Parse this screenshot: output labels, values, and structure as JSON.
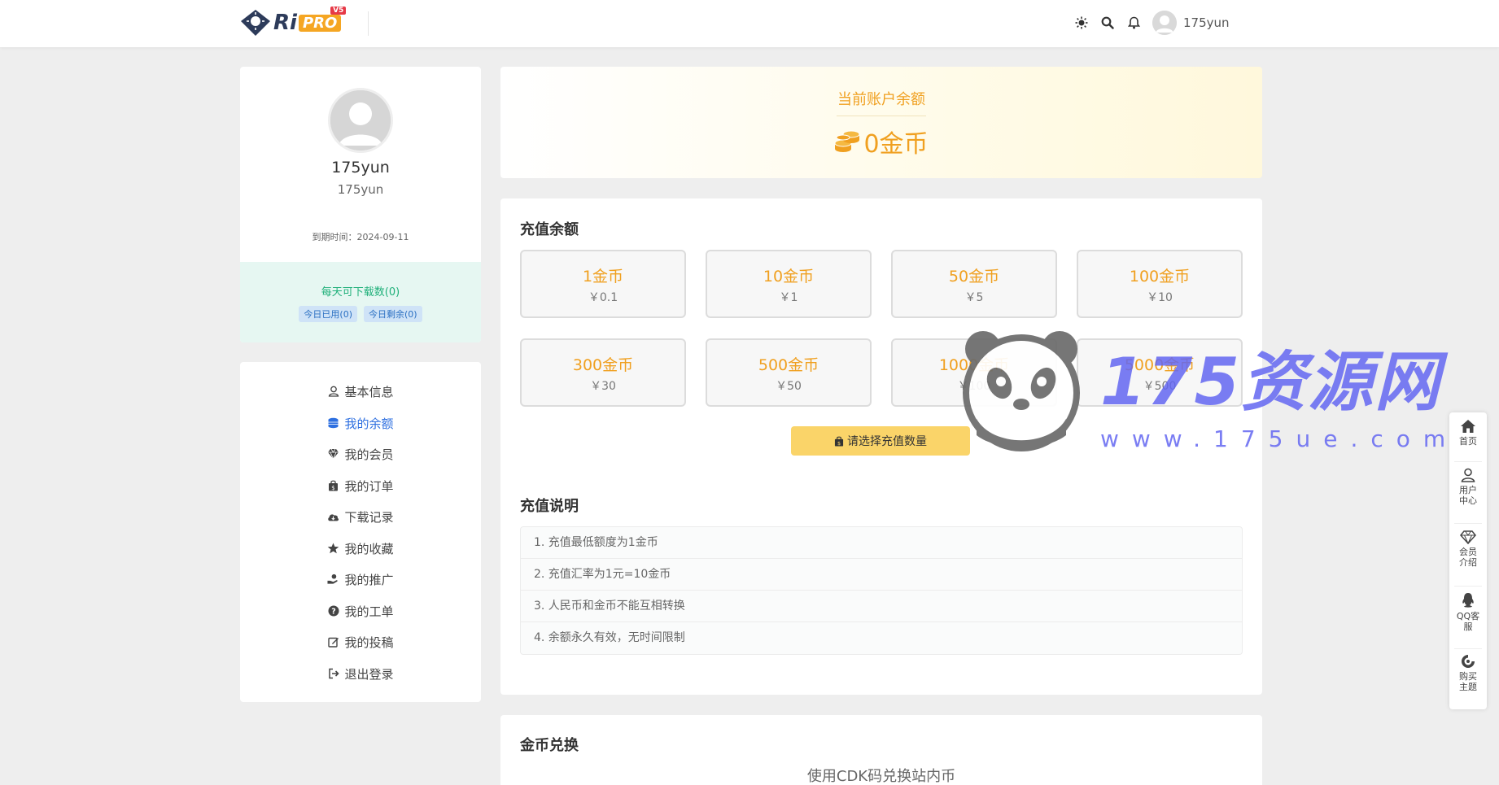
{
  "header": {
    "logo_text": "Ri",
    "logo_pro": "PRO",
    "logo_version": "V5",
    "username": "175yun",
    "icons": [
      "sun-icon",
      "search-icon",
      "bell-icon",
      "avatar"
    ]
  },
  "user_card": {
    "name": "175yun",
    "subname": "175yun",
    "expire": "到期时间：2024-09-11",
    "downloads_title": "每天可下载数(0)",
    "badge_used": "今日已用(0)",
    "badge_left": "今日剩余(0)"
  },
  "menu": {
    "items": [
      {
        "label": "基本信息",
        "icon": "user-icon"
      },
      {
        "label": "我的余额",
        "icon": "coins-icon"
      },
      {
        "label": "我的会员",
        "icon": "diamond-icon"
      },
      {
        "label": "我的订单",
        "icon": "bag-icon"
      },
      {
        "label": "下载记录",
        "icon": "cloud-download-icon"
      },
      {
        "label": "我的收藏",
        "icon": "star-icon"
      },
      {
        "label": "我的推广",
        "icon": "hand-coin-icon"
      },
      {
        "label": "我的工单",
        "icon": "question-icon"
      },
      {
        "label": "我的投稿",
        "icon": "edit-icon"
      },
      {
        "label": "退出登录",
        "icon": "logout-icon"
      }
    ],
    "active_index": 1
  },
  "balance": {
    "label": "当前账户余额",
    "amount": "0金币"
  },
  "recharge": {
    "title": "充值余额",
    "packages": [
      {
        "coins": "1金币",
        "price": "￥0.1"
      },
      {
        "coins": "10金币",
        "price": "￥1"
      },
      {
        "coins": "50金币",
        "price": "￥5"
      },
      {
        "coins": "100金币",
        "price": "￥10"
      },
      {
        "coins": "300金币",
        "price": "￥30"
      },
      {
        "coins": "500金币",
        "price": "￥50"
      },
      {
        "coins": "1000金币",
        "price": "￥100"
      },
      {
        "coins": "5000金币",
        "price": "￥500"
      }
    ],
    "button_label": "请选择充值数量",
    "notes_title": "充值说明",
    "notes": [
      "1. 充值最低额度为1金币",
      "2. 充值汇率为1元=10金币",
      "3. 人民币和金币不能互相转换",
      "4. 余额永久有效，无时间限制"
    ]
  },
  "exchange": {
    "title": "金币兑换",
    "subtitle": "使用CDK码兑换站内币"
  },
  "watermark": {
    "text": "175资源网",
    "url": "www.175ue.com"
  },
  "float_bar": {
    "items": [
      {
        "label": "首页",
        "icon": "home-icon"
      },
      {
        "label": "用户中心",
        "icon": "user-icon"
      },
      {
        "label": "会员介绍",
        "icon": "diamond-icon"
      },
      {
        "label": "QQ客服",
        "icon": "qq-icon"
      },
      {
        "label": "购买主题",
        "icon": "theme-icon"
      }
    ]
  },
  "colors": {
    "accent_gold": "#f0a020",
    "active_blue": "#2d6fe0",
    "download_bg": "#e6f7f2",
    "button_yellow": "#fad469"
  }
}
